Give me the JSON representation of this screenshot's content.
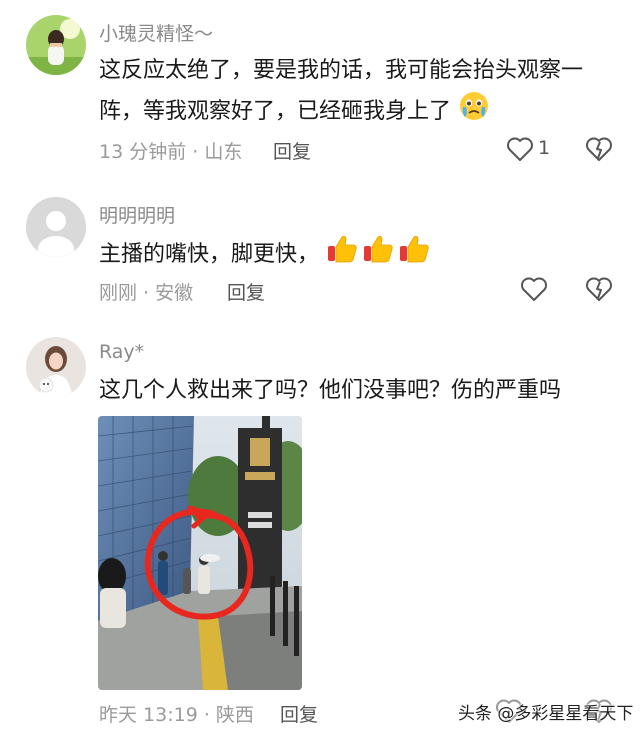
{
  "comments": [
    {
      "username": "小瑰灵精怪～",
      "text": "这反应太绝了，要是我的话，我可能会抬头观察一阵，等我观察好了，已经砸我身上了",
      "emoji": "crying-emoji",
      "time_location": "13 分钟前 · 山东",
      "reply_label": "回复",
      "like_count": "1"
    },
    {
      "username": "明明明明",
      "text": "主播的嘴快，脚更快，",
      "emoji": "thumbs-up-emoji",
      "time_location": "刚刚 · 安徽",
      "reply_label": "回复"
    },
    {
      "username": "Ray*",
      "text": "这几个人救出来了吗？他们没事吧？伤的严重吗",
      "time_location": "昨天 13:19 · 陕西",
      "reply_label": "回复"
    }
  ],
  "watermark": "头条 @多彩星星看天下",
  "colors": {
    "username": "#8a8a8a",
    "meta": "#9a9a9a",
    "annotation_circle": "#e8281e"
  }
}
